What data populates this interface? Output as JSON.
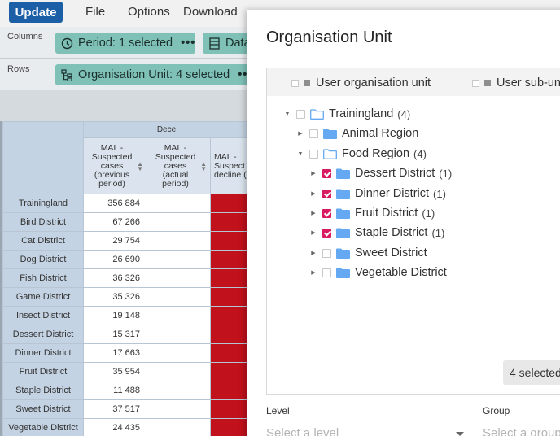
{
  "topbar": {
    "update_label": "Update",
    "menus": [
      "File",
      "Options",
      "Download"
    ]
  },
  "layout": {
    "columns_label": "Columns",
    "rows_label": "Rows",
    "period_chip": "Period: 1 selected",
    "data_chip": "Data",
    "ou_chip": "Organisation Unit: 4 selected",
    "more": "•••"
  },
  "pivot": {
    "period_header": "Dece",
    "col_headers": [
      "MAL - Suspected cases (previous period)",
      "MAL - Suspected cases (actual period)",
      "MAL - Suspect decline ("
    ],
    "rows": [
      {
        "name": "Trainingland",
        "value": "356 884"
      },
      {
        "name": "Bird District",
        "value": "67 266"
      },
      {
        "name": "Cat District",
        "value": "29 754"
      },
      {
        "name": "Dog District",
        "value": "26 690"
      },
      {
        "name": "Fish District",
        "value": "36 326"
      },
      {
        "name": "Game District",
        "value": "35 326"
      },
      {
        "name": "Insect District",
        "value": "19 148"
      },
      {
        "name": "Dessert District",
        "value": "15 317"
      },
      {
        "name": "Dinner District",
        "value": "17 663"
      },
      {
        "name": "Fruit District",
        "value": "35 954"
      },
      {
        "name": "Staple District",
        "value": "11 488"
      },
      {
        "name": "Sweet District",
        "value": "37 517"
      },
      {
        "name": "Vegetable District",
        "value": "24 435"
      }
    ],
    "accent_red": "#c0111c"
  },
  "modal": {
    "title": "Organisation Unit",
    "user_org_unit": "User organisation unit",
    "user_sub_unit": "User sub-uni",
    "tree": [
      {
        "label": "Trainingland",
        "count": "(4)",
        "checked": false,
        "open": true,
        "folder": "outline"
      },
      {
        "label": "Animal Region",
        "count": "",
        "checked": false,
        "open": false,
        "folder": "solid"
      },
      {
        "label": "Food Region",
        "count": "(4)",
        "checked": false,
        "open": true,
        "folder": "outline"
      },
      {
        "label": "Dessert District",
        "count": "(1)",
        "checked": true,
        "open": false,
        "folder": "solid"
      },
      {
        "label": "Dinner District",
        "count": "(1)",
        "checked": true,
        "open": false,
        "folder": "solid"
      },
      {
        "label": "Fruit District",
        "count": "(1)",
        "checked": true,
        "open": false,
        "folder": "solid"
      },
      {
        "label": "Staple District",
        "count": "(1)",
        "checked": true,
        "open": false,
        "folder": "solid"
      },
      {
        "label": "Sweet District",
        "count": "",
        "checked": false,
        "open": false,
        "folder": "solid"
      },
      {
        "label": "Vegetable District",
        "count": "",
        "checked": false,
        "open": false,
        "folder": "solid"
      }
    ],
    "selected_badge": "4 selected",
    "level_label": "Level",
    "level_placeholder": "Select a level",
    "group_label": "Group",
    "group_placeholder": "Select a group",
    "check_color": "#d81b60",
    "folder_color": "#64a9f2"
  }
}
